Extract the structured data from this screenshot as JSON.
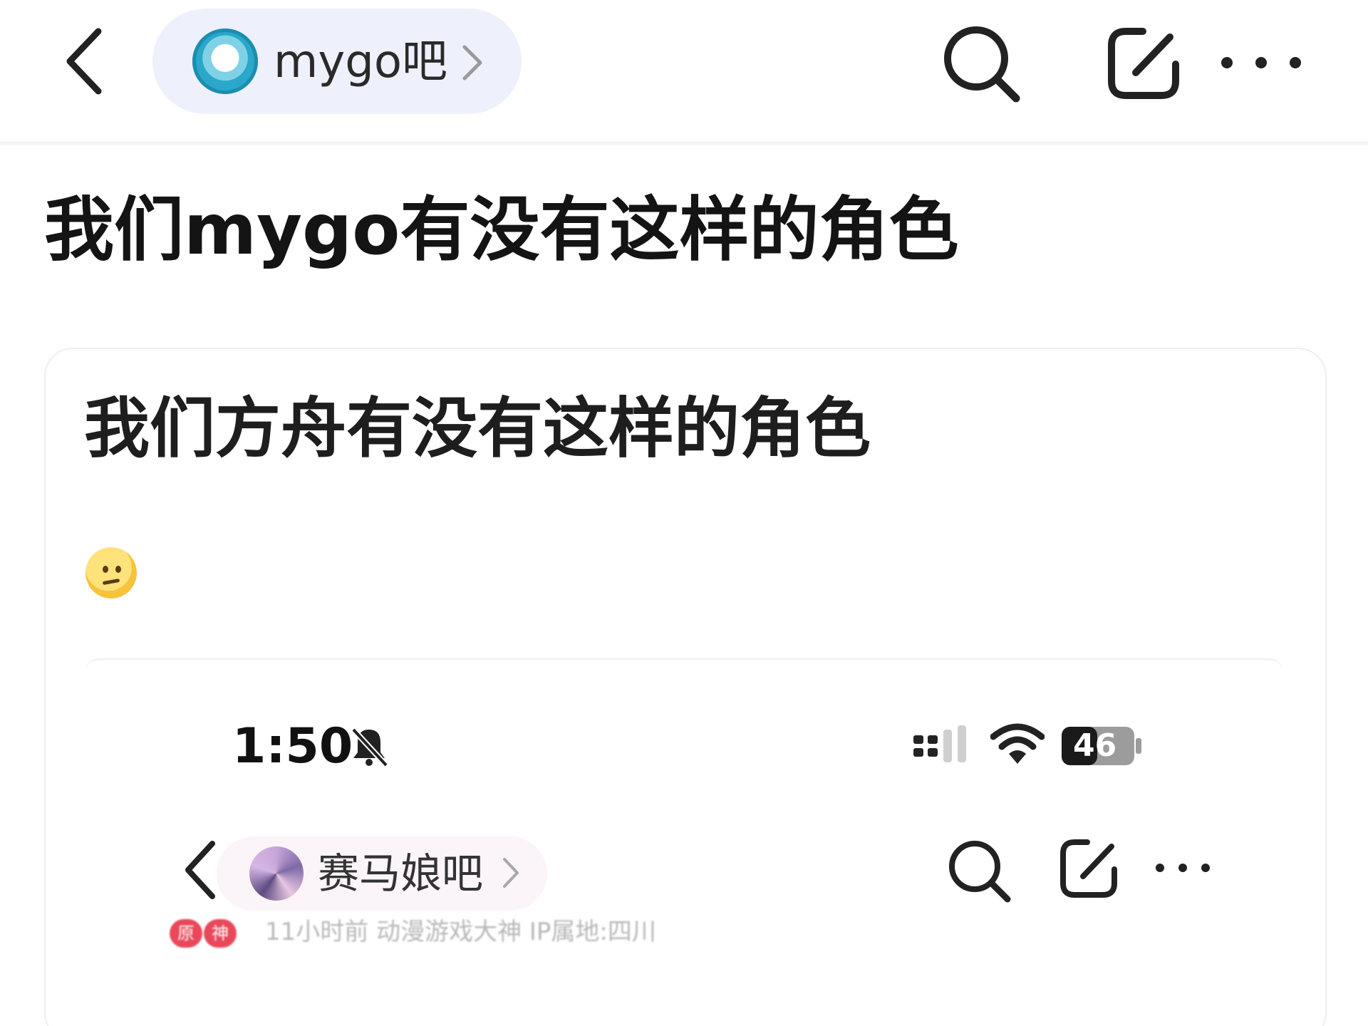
{
  "header": {
    "forum_name": "mygo吧"
  },
  "post": {
    "title": "我们mygo有没有这样的角色"
  },
  "embedded_post": {
    "title": "我们方舟有没有这样的角色",
    "emoji": "thinking-face",
    "inner_screenshot": {
      "status_time": "1:50",
      "battery": "46",
      "forum_name": "赛马娘吧",
      "meta_text": "11小时前  动漫游戏大神  IP属地:四川",
      "badges": [
        "原",
        "神"
      ]
    }
  },
  "colors": {
    "pill_bg": "#eef1fb",
    "inner_pill_bg": "#fbf4f8",
    "badge_red": "#e9485a"
  }
}
